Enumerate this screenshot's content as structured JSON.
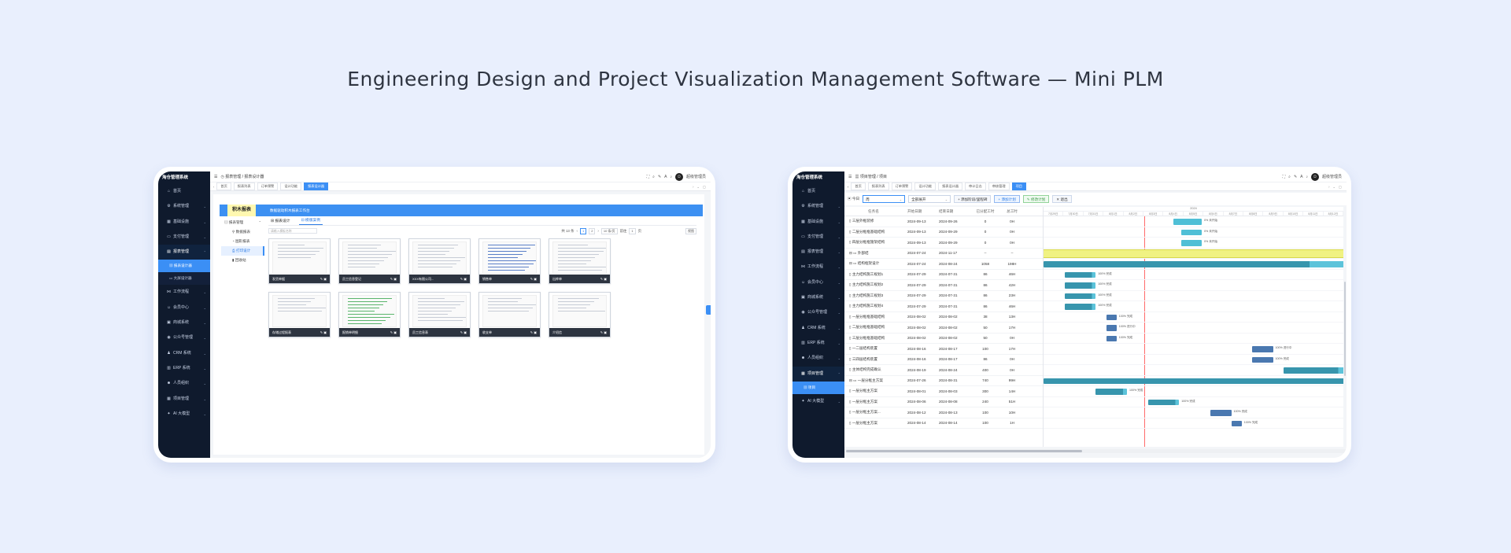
{
  "headline": "Engineering Design and Project Visualization Management Software — Mini PLM",
  "app1": {
    "sidebar": {
      "logo": "淘仓管理系统",
      "items": [
        {
          "label": "首页",
          "icon": "home-icon",
          "glyph": "⌂",
          "caret": ""
        },
        {
          "label": "系统管理",
          "icon": "gear-icon",
          "glyph": "⚙",
          "caret": "⌄"
        },
        {
          "label": "基础设施",
          "icon": "grid-icon",
          "glyph": "▦",
          "caret": "⌄"
        },
        {
          "label": "支付管理",
          "icon": "card-icon",
          "glyph": "▭",
          "caret": "⌄"
        },
        {
          "label": "报表管理",
          "icon": "report-icon",
          "glyph": "▤",
          "caret": "⌃"
        }
      ],
      "subitems": [
        "报表设计器",
        "大屏设计器"
      ],
      "items2": [
        {
          "label": "工作流程",
          "icon": "flow-icon",
          "glyph": "⋈",
          "caret": "⌄"
        },
        {
          "label": "会员中心",
          "icon": "user-icon",
          "glyph": "☺",
          "caret": "⌄"
        },
        {
          "label": "商城系统",
          "icon": "shop-icon",
          "glyph": "▣",
          "caret": "⌄"
        },
        {
          "label": "公众号管理",
          "icon": "wechat-icon",
          "glyph": "◉",
          "caret": "⌄"
        },
        {
          "label": "CRM 系统",
          "icon": "crm-icon",
          "glyph": "♟",
          "caret": "⌄"
        },
        {
          "label": "ERP 系统",
          "icon": "erp-icon",
          "glyph": "▥",
          "caret": "⌄"
        },
        {
          "label": "人员组织",
          "icon": "people-icon",
          "glyph": "☻",
          "caret": "⌄"
        },
        {
          "label": "项目管理",
          "icon": "project-icon",
          "glyph": "▦",
          "caret": "⌄"
        },
        {
          "label": "AI 大模型",
          "icon": "ai-icon",
          "glyph": "✦",
          "caret": "⌄"
        }
      ]
    },
    "header": {
      "breadcrumb": "◷ 报表管理 / 报表设计器",
      "user": "超级管理员"
    },
    "tabs": [
      "首页",
      "报表列表",
      "订单预警",
      "设计功能",
      "报表设计器"
    ],
    "banner": {
      "logo": "积木报表",
      "text": "数据驱动积木报表工作台"
    },
    "tree": {
      "root": "报表管理",
      "children": [
        "数据报表",
        "图形报表",
        "打印设计",
        "回收站"
      ]
    },
    "right_tabs": [
      "报表设计",
      "模版案例"
    ],
    "toolbar": {
      "search_placeholder": "请输入模板名称",
      "total": "共 13 条",
      "pages": [
        "1",
        "2"
      ],
      "page_size": "10 条/页",
      "goto": "前往",
      "goto_page": "1",
      "goto_unit": "页",
      "view": "视图"
    },
    "cards": [
      {
        "title": "发货单据",
        "style": "doc"
      },
      {
        "title": "员工信息登记",
        "style": "form"
      },
      {
        "title": "XXX有限公司...",
        "style": "form"
      },
      {
        "title": "销售单",
        "style": "blu"
      },
      {
        "title": "出库单",
        "style": "table"
      },
      {
        "title": "存储过程报表",
        "style": "doc"
      },
      {
        "title": "报销单明细",
        "style": "grn"
      },
      {
        "title": "员工信息表",
        "style": "form"
      },
      {
        "title": "收支单",
        "style": "doc"
      },
      {
        "title": "介绍信",
        "style": "doc"
      }
    ]
  },
  "app2": {
    "sidebar": {
      "logo": "淘仓管理系统",
      "items": [
        {
          "label": "首页",
          "icon": "home-icon",
          "glyph": "⌂",
          "caret": ""
        },
        {
          "label": "系统管理",
          "icon": "gear-icon",
          "glyph": "⚙",
          "caret": "⌄"
        },
        {
          "label": "基础设施",
          "icon": "grid-icon",
          "glyph": "▦",
          "caret": "⌄"
        },
        {
          "label": "支付管理",
          "icon": "card-icon",
          "glyph": "▭",
          "caret": "⌄"
        },
        {
          "label": "报表管理",
          "icon": "report-icon",
          "glyph": "▤",
          "caret": "⌄"
        },
        {
          "label": "工作流程",
          "icon": "flow-icon",
          "glyph": "⋈",
          "caret": "⌄"
        },
        {
          "label": "会员中心",
          "icon": "user-icon",
          "glyph": "☺",
          "caret": "⌄"
        },
        {
          "label": "商城系统",
          "icon": "shop-icon",
          "glyph": "▣",
          "caret": "⌄"
        },
        {
          "label": "公众号管理",
          "icon": "wechat-icon",
          "glyph": "◉",
          "caret": "⌄"
        },
        {
          "label": "CRM 系统",
          "icon": "crm-icon",
          "glyph": "♟",
          "caret": "⌄"
        },
        {
          "label": "ERP 系统",
          "icon": "erp-icon",
          "glyph": "▥",
          "caret": "⌄"
        },
        {
          "label": "人员组织",
          "icon": "people-icon",
          "glyph": "☻",
          "caret": "⌄"
        },
        {
          "label": "项目管理",
          "icon": "project-icon",
          "glyph": "▦",
          "caret": "⌃"
        }
      ],
      "subitem": "项目",
      "items2": [
        {
          "label": "AI 大模型",
          "icon": "ai-icon",
          "glyph": "✦",
          "caret": "⌄"
        }
      ]
    },
    "header": {
      "breadcrumb": "▦ 项目管理 / 项目",
      "user": "超级管理员"
    },
    "tabs": [
      "首页",
      "报表列表",
      "订单预警",
      "设计功能",
      "报表设计器",
      "审计日志",
      "审核管理",
      "项目"
    ],
    "toolbar": {
      "today": "今日",
      "scale": "周",
      "expand": "全部展开",
      "add_milestone": "添加阶段/里程碑",
      "add_plan": "添加计划",
      "update_plan": "修改计划",
      "exit": "退出"
    },
    "columns": [
      "任务名",
      "开始日期",
      "结束日期",
      "已分配工时",
      "总工时"
    ],
    "timeline": {
      "year": "2024",
      "days": [
        "7月29日",
        "7月30日",
        "7月31日",
        "8月1日",
        "8月2日",
        "8月3日",
        "8月4日",
        "8月5日",
        "8月6日",
        "8月7日",
        "8月8日",
        "8月9日",
        "8月10日",
        "8月11日",
        "8月12日"
      ]
    },
    "tasks": [
      {
        "name": "三层外框装修",
        "start": "2024-09-13",
        "end": "2024-09-26",
        "assigned": "0",
        "total": "0H",
        "bar": null
      },
      {
        "name": "二层分框框基础结构",
        "start": "2024-09-13",
        "end": "2024-09-29",
        "assigned": "0",
        "total": "0H",
        "bar": null
      },
      {
        "name": "四层分框框施架结构",
        "start": "2024-09-13",
        "end": "2024-09-29",
        "assigned": "0",
        "total": "0H",
        "bar": null
      },
      {
        "name": "外部结",
        "start": "2024-07-24",
        "end": "2024-11-17",
        "assigned": "--",
        "total": "--",
        "bar": null
      },
      {
        "name": "结构框架设计",
        "start": "2024-07-24",
        "end": "2024-08-24",
        "assigned": "1058",
        "total": "198H",
        "bar": {
          "progress": "94%",
          "status": "进行中"
        }
      },
      {
        "name": "主力结构施工规划1",
        "start": "2024-07-29",
        "end": "2024-07-31",
        "assigned": "86",
        "total": "46H",
        "bar": {
          "progress": "100%",
          "status": "完成"
        }
      },
      {
        "name": "主力结构施工规划2",
        "start": "2024-07-29",
        "end": "2024-07-31",
        "assigned": "86",
        "total": "42H",
        "bar": {
          "progress": "100%",
          "status": "完成"
        }
      },
      {
        "name": "主力结构施工规划3",
        "start": "2024-07-29",
        "end": "2024-07-31",
        "assigned": "86",
        "total": "23H",
        "bar": {
          "progress": "100%",
          "status": "完成"
        }
      },
      {
        "name": "主力结构施工规划4",
        "start": "2024-07-29",
        "end": "2024-07-31",
        "assigned": "86",
        "total": "46H",
        "bar": {
          "progress": "100%",
          "status": "完成"
        }
      },
      {
        "name": "一层分框框基础结构",
        "start": "2024-08-02",
        "end": "2024-08-02",
        "assigned": "38",
        "total": "13H",
        "bar": {
          "progress": "100%",
          "status": "完成"
        }
      },
      {
        "name": "二层分框框基础结构",
        "start": "2024-08-02",
        "end": "2024-08-02",
        "assigned": "50",
        "total": "17H",
        "bar": {
          "progress": "100%",
          "status": "进行中"
        }
      },
      {
        "name": "三层分框框基础结构",
        "start": "2024-08-02",
        "end": "2024-08-02",
        "assigned": "50",
        "total": "0H",
        "bar": {
          "progress": "100%",
          "status": "完成"
        }
      },
      {
        "name": "一二层结构装置",
        "start": "2024-08-16",
        "end": "2024-08-17",
        "assigned": "100",
        "total": "17H",
        "bar": {
          "progress": "100%",
          "status": "进行中"
        }
      },
      {
        "name": "三四层结构装置",
        "start": "2024-08-16",
        "end": "2024-08-17",
        "assigned": "86",
        "total": "0H",
        "bar": {
          "progress": "100%",
          "status": "完成"
        }
      },
      {
        "name": "主体结构完成确认",
        "start": "2024-08-19",
        "end": "2024-08-24",
        "assigned": "400",
        "total": "0H",
        "bar": {
          "progress": "0%",
          "status": "进行中"
        }
      },
      {
        "name": "一层分框主方案",
        "start": "2024-07-26",
        "end": "2024-08-31",
        "assigned": "740",
        "total": "99H",
        "bar": {
          "progress": "94%",
          "status": "进行中"
        }
      },
      {
        "name": "一层分框主方案",
        "start": "2024-08-01",
        "end": "2024-08-03",
        "assigned": "300",
        "total": "14H",
        "bar": {
          "progress": "100%",
          "status": "完成"
        }
      },
      {
        "name": "一层分框主方案",
        "start": "2024-08-06",
        "end": "2024-08-08",
        "assigned": "240",
        "total": "51H",
        "bar": {
          "progress": "100%",
          "status": "完成"
        }
      },
      {
        "name": "一层分框主方案...",
        "start": "2024-08-12",
        "end": "2024-08-13",
        "assigned": "100",
        "total": "10H",
        "bar": {
          "progress": "100%",
          "status": "完成"
        }
      },
      {
        "name": "一层分框主方案",
        "start": "2024-08-14",
        "end": "2024-08-14",
        "assigned": "100",
        "total": "1H",
        "bar": {
          "progress": "100%",
          "status": "完成"
        }
      }
    ]
  },
  "colors": {
    "accent": "#3b8ff5",
    "sidebar": "#0f1a2d",
    "bar": "#3aa0b8",
    "summary": "#f0f282",
    "today": "#ff6b6b"
  }
}
